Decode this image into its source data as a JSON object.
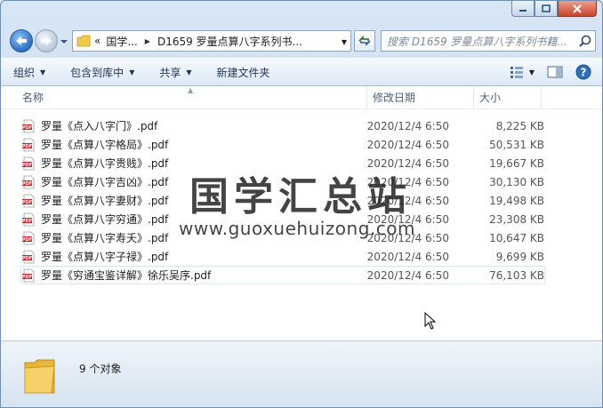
{
  "address": {
    "overflow": "«",
    "crumbs": [
      "国学...",
      "D1659 罗量点算八字系列书..."
    ]
  },
  "search": {
    "placeholder": "搜索 D1659 罗量点算八字系列书籍..."
  },
  "toolbar": {
    "organize": "组织",
    "include_in_library": "包含到库中",
    "share": "共享",
    "new_folder": "新建文件夹"
  },
  "columns": {
    "name": "名称",
    "date": "修改日期",
    "size": "大小"
  },
  "files": [
    {
      "name": "罗量《点入八字门》.pdf",
      "date": "2020/12/4 6:50",
      "size": "8,225 KB"
    },
    {
      "name": "罗量《点算八字格局》.pdf",
      "date": "2020/12/4 6:50",
      "size": "50,531 KB"
    },
    {
      "name": "罗量《点算八字贵贱》.pdf",
      "date": "2020/12/4 6:50",
      "size": "19,667 KB"
    },
    {
      "name": "罗量《点算八字吉凶》.pdf",
      "date": "2020/12/4 6:50",
      "size": "30,130 KB"
    },
    {
      "name": "罗量《点算八字妻财》.pdf",
      "date": "2020/12/4 6:50",
      "size": "19,498 KB"
    },
    {
      "name": "罗量《点算八字穷通》.pdf",
      "date": "2020/12/4 6:50",
      "size": "23,308 KB"
    },
    {
      "name": "罗量《点算八字寿夭》.pdf",
      "date": "2020/12/4 6:50",
      "size": "10,647 KB"
    },
    {
      "name": "罗量《点算八字子禄》.pdf",
      "date": "2020/12/4 6:50",
      "size": "9,699 KB"
    },
    {
      "name": "罗量《穷通宝鉴详解》徐乐吴序.pdf",
      "date": "2020/12/4 6:50",
      "size": "76,103 KB"
    }
  ],
  "selected_index": 8,
  "watermark": {
    "title": "国学汇总站",
    "url": "www.guoxuehuizong.com"
  },
  "status": {
    "count": "9 个对象"
  },
  "icons": {
    "back": "back-arrow-icon",
    "forward": "forward-arrow-icon",
    "refresh": "refresh-icon",
    "search": "search-icon",
    "views": "views-icon",
    "preview": "preview-pane-icon",
    "help": "help-icon",
    "pdf": "pdf-file-icon",
    "folder": "folder-icon"
  },
  "colors": {
    "accent": "#2d6fbf",
    "pdf_red": "#c8282c",
    "folder": "#f2c94c"
  }
}
